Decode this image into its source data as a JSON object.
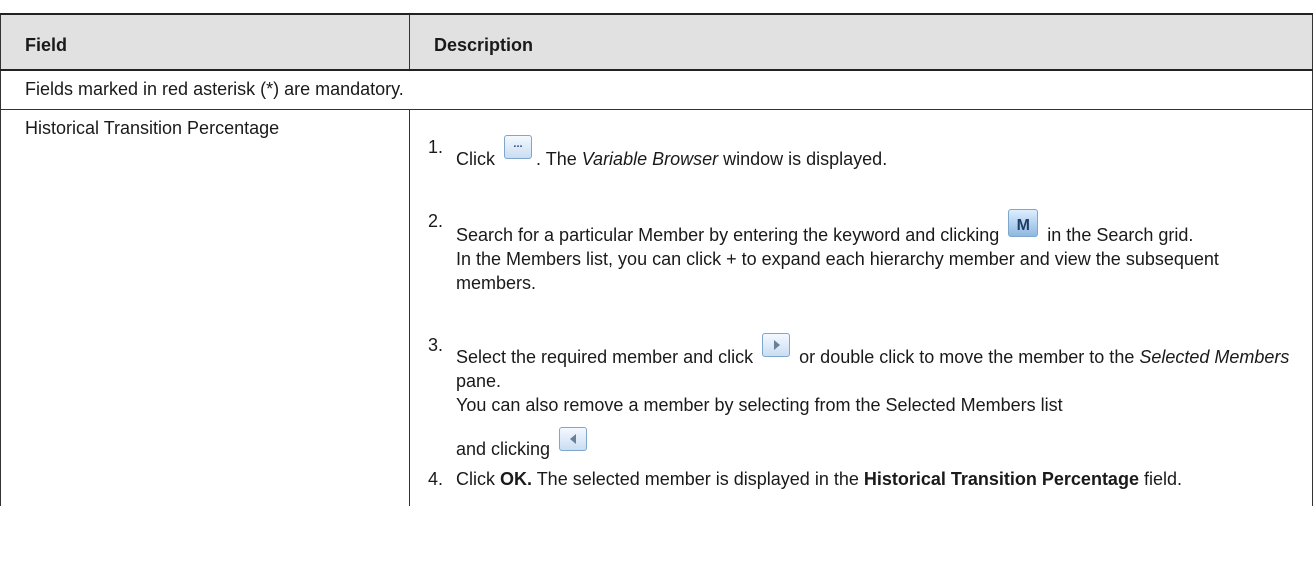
{
  "table": {
    "header": {
      "field": "Field",
      "description": "Description"
    },
    "note": "Fields marked in red asterisk (*) are mandatory.",
    "row": {
      "field": "Historical Transition Percentage",
      "steps": [
        {
          "num": "1.",
          "a": "Click",
          "icon": "ellipsis-button-icon",
          "b": ". The ",
          "i1": "Variable Browser",
          "c": " window is displayed."
        },
        {
          "num": "2.",
          "a": "Search for a particular Member by entering the keyword and clicking",
          "icon": "binoculars-search-icon",
          "b": "in the Search grid.",
          "line2": "In the Members list, you can click + to expand each hierarchy member and view the subsequent members."
        },
        {
          "num": "3.",
          "a": "Select the required member and click",
          "icon": "arrow-right-icon",
          "b": "or double click to move the member to the ",
          "i1": "Selected Members",
          "c": " pane.",
          "line2": "You can also remove a member by selecting from the Selected Members list",
          "line3": "and clicking",
          "icon2": "arrow-left-icon"
        },
        {
          "num": "4.",
          "a": "Click ",
          "b1": "OK.",
          "b": " The selected member is displayed in the ",
          "b2": "Historical Transition Percentage",
          "c": " field."
        }
      ]
    }
  }
}
